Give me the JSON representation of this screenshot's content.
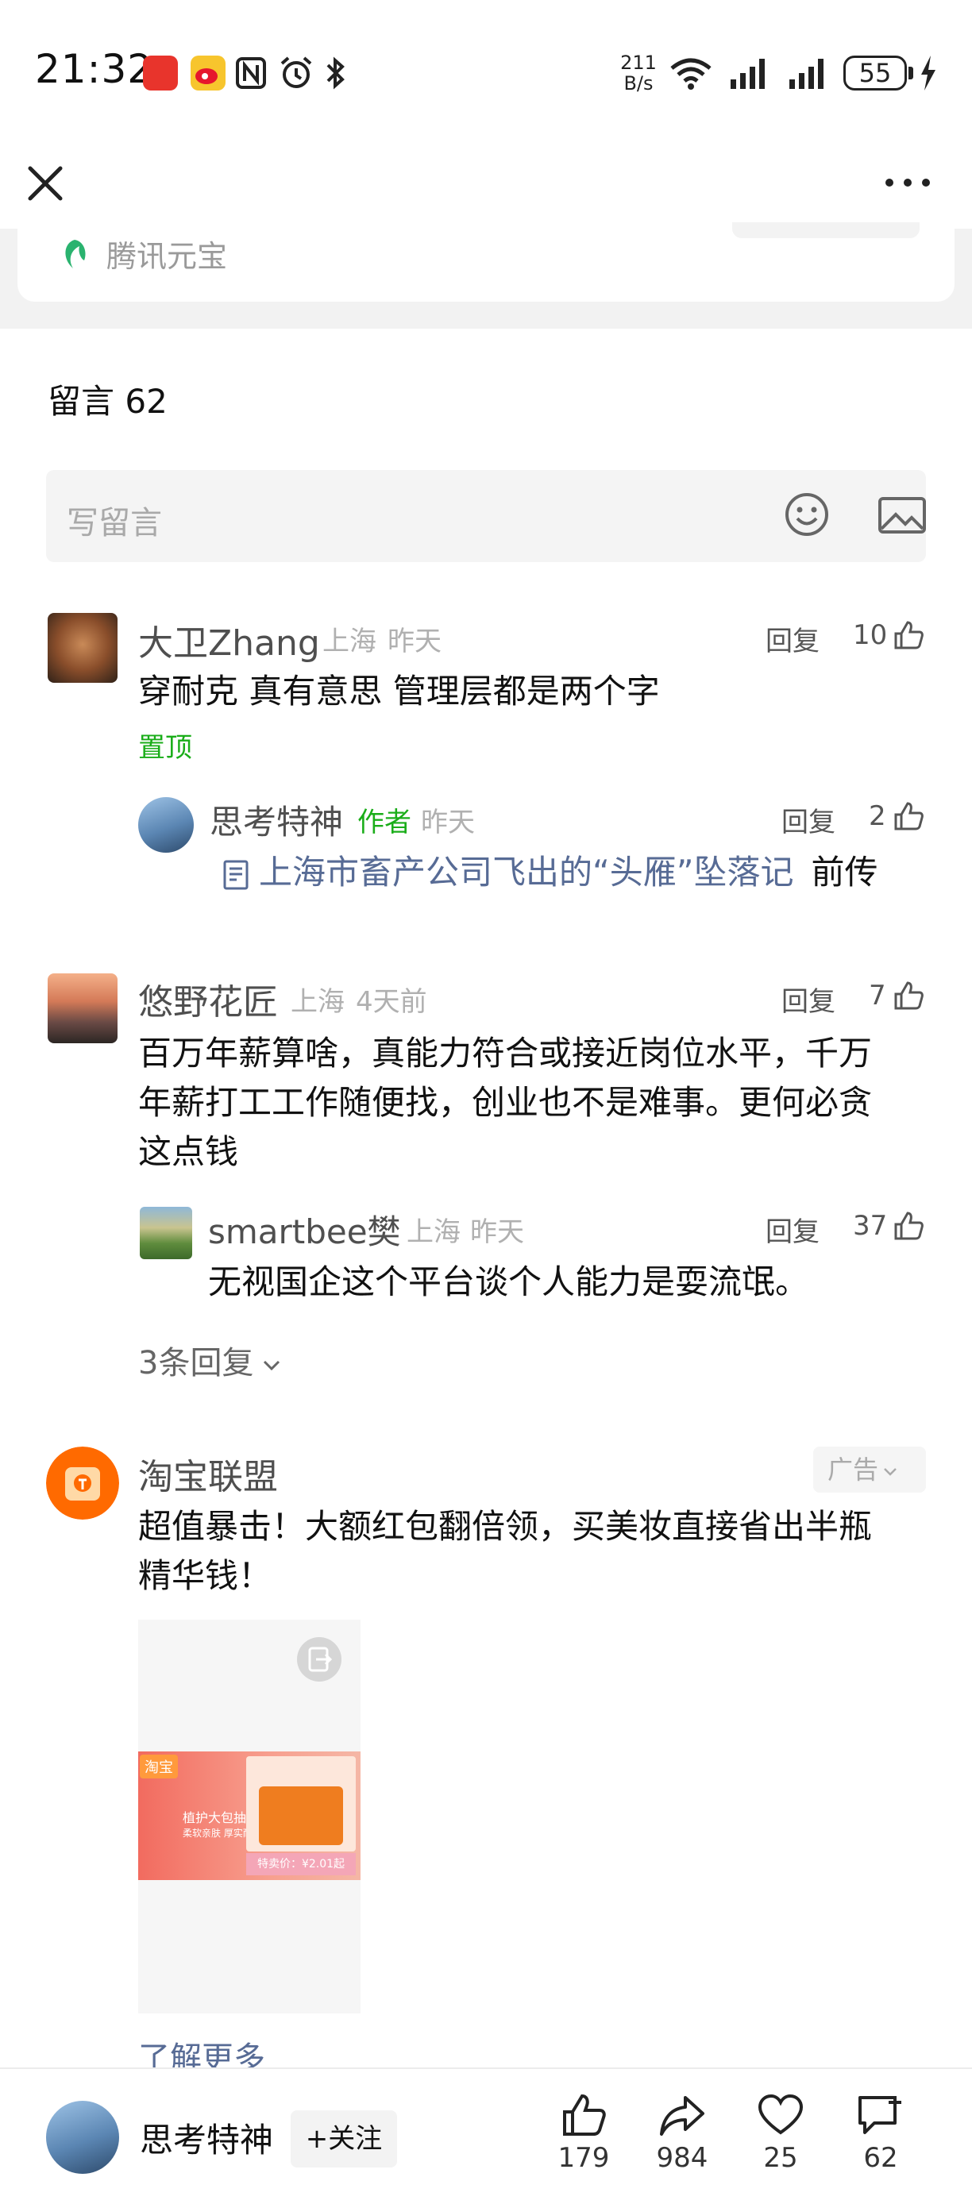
{
  "status_bar": {
    "time": "21:32",
    "net_speed_value": "211",
    "net_speed_unit": "B/s",
    "battery": "55"
  },
  "nav": {
    "close_icon": "close-icon",
    "more_icon": "more-dots-icon"
  },
  "article_source": {
    "label": "腾讯元宝"
  },
  "comments": {
    "title": "留言 62",
    "input_placeholder": "写留言",
    "items": [
      {
        "name": "大卫Zhang",
        "location": "上海",
        "time": "昨天",
        "reply_label": "回复",
        "likes": "10",
        "text": "穿耐克 真有意思 管理层都是两个字",
        "pinned_label": "置顶",
        "replies": [
          {
            "name": "思考特神",
            "author_tag": "作者",
            "time": "昨天",
            "reply_label": "回复",
            "likes": "2",
            "link_text": "上海市畜产公司飞出的“头雁”坠落记",
            "tail_text": "前传"
          }
        ]
      },
      {
        "name": "悠野花匠",
        "location": "上海",
        "time": "4天前",
        "reply_label": "回复",
        "likes": "7",
        "text_line1": "百万年薪算啥，真能力符合或接近岗位水平，千万",
        "text_line2": "年薪打工工作随便找，创业也不是难事。更何必贪",
        "text_line3": "这点钱",
        "replies": [
          {
            "name": "smartbee樊",
            "location": "上海",
            "time": "昨天",
            "reply_label": "回复",
            "likes": "37",
            "text": "无视国企这个平台谈个人能力是耍流氓。"
          }
        ],
        "more_replies": "3条回复"
      }
    ]
  },
  "ad": {
    "name": "淘宝联盟",
    "badge": "广告",
    "text_line1": "超值暴击！大额红包翻倍领，买美妆直接省出半瓶",
    "text_line2": "精华钱！",
    "banner_brand": "淘宝",
    "banner_title": "植护大包抽纸",
    "banner_sub": "柔软亲肤 厚实耐用",
    "banner_price": "特卖价：¥2.01起",
    "learn_more": "了解更多"
  },
  "bottom_bar": {
    "author": "思考特神",
    "follow_label": "+关注",
    "like_count": "179",
    "share_count": "984",
    "favorite_count": "25",
    "comment_count": "62"
  },
  "colors": {
    "link": "#576b95",
    "green": "#1aad19",
    "muted": "#b0b0b0"
  }
}
